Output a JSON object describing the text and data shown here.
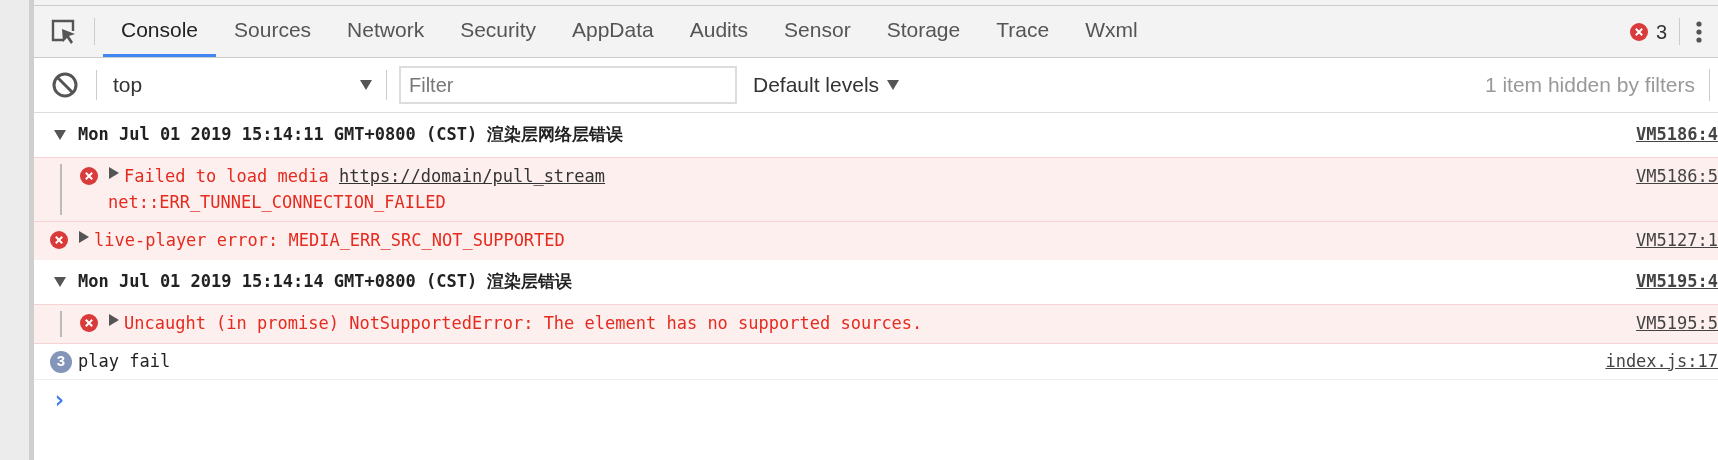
{
  "tabs": [
    {
      "label": "Console",
      "selected": true
    },
    {
      "label": "Sources",
      "selected": false
    },
    {
      "label": "Network",
      "selected": false
    },
    {
      "label": "Security",
      "selected": false
    },
    {
      "label": "AppData",
      "selected": false
    },
    {
      "label": "Audits",
      "selected": false
    },
    {
      "label": "Sensor",
      "selected": false
    },
    {
      "label": "Storage",
      "selected": false
    },
    {
      "label": "Trace",
      "selected": false
    },
    {
      "label": "Wxml",
      "selected": false
    }
  ],
  "error_count": "3",
  "toolbar": {
    "context": "top",
    "filter": {
      "placeholder": "Filter"
    },
    "levels": "Default levels",
    "hidden_note": "1 item hidden by filters"
  },
  "messages": [
    {
      "kind": "group",
      "expanded": true,
      "text": "Mon Jul 01 2019 15:14:11 GMT+0800 (CST) 渲染层网络层错误",
      "source": "VM5186:4",
      "children": [
        {
          "kind": "error",
          "text": "Failed to load media ",
          "link": "https://domain/pull_stream",
          "detail": "net::ERR_TUNNEL_CONNECTION_FAILED",
          "source": "VM5186:5"
        }
      ]
    },
    {
      "kind": "error",
      "text": "live-player error: MEDIA_ERR_SRC_NOT_SUPPORTED",
      "source": "VM5127:1"
    },
    {
      "kind": "group",
      "expanded": true,
      "text": "Mon Jul 01 2019 15:14:14 GMT+0800 (CST) 渲染层错误",
      "source": "VM5195:4",
      "children": [
        {
          "kind": "error",
          "text": "Uncaught (in promise) NotSupportedError: The element has no supported sources.",
          "source": "VM5195:5"
        }
      ]
    },
    {
      "kind": "log",
      "count": "3",
      "text": "play fail",
      "source": "index.js:17"
    },
    {
      "kind": "prompt",
      "text": "›"
    }
  ]
}
